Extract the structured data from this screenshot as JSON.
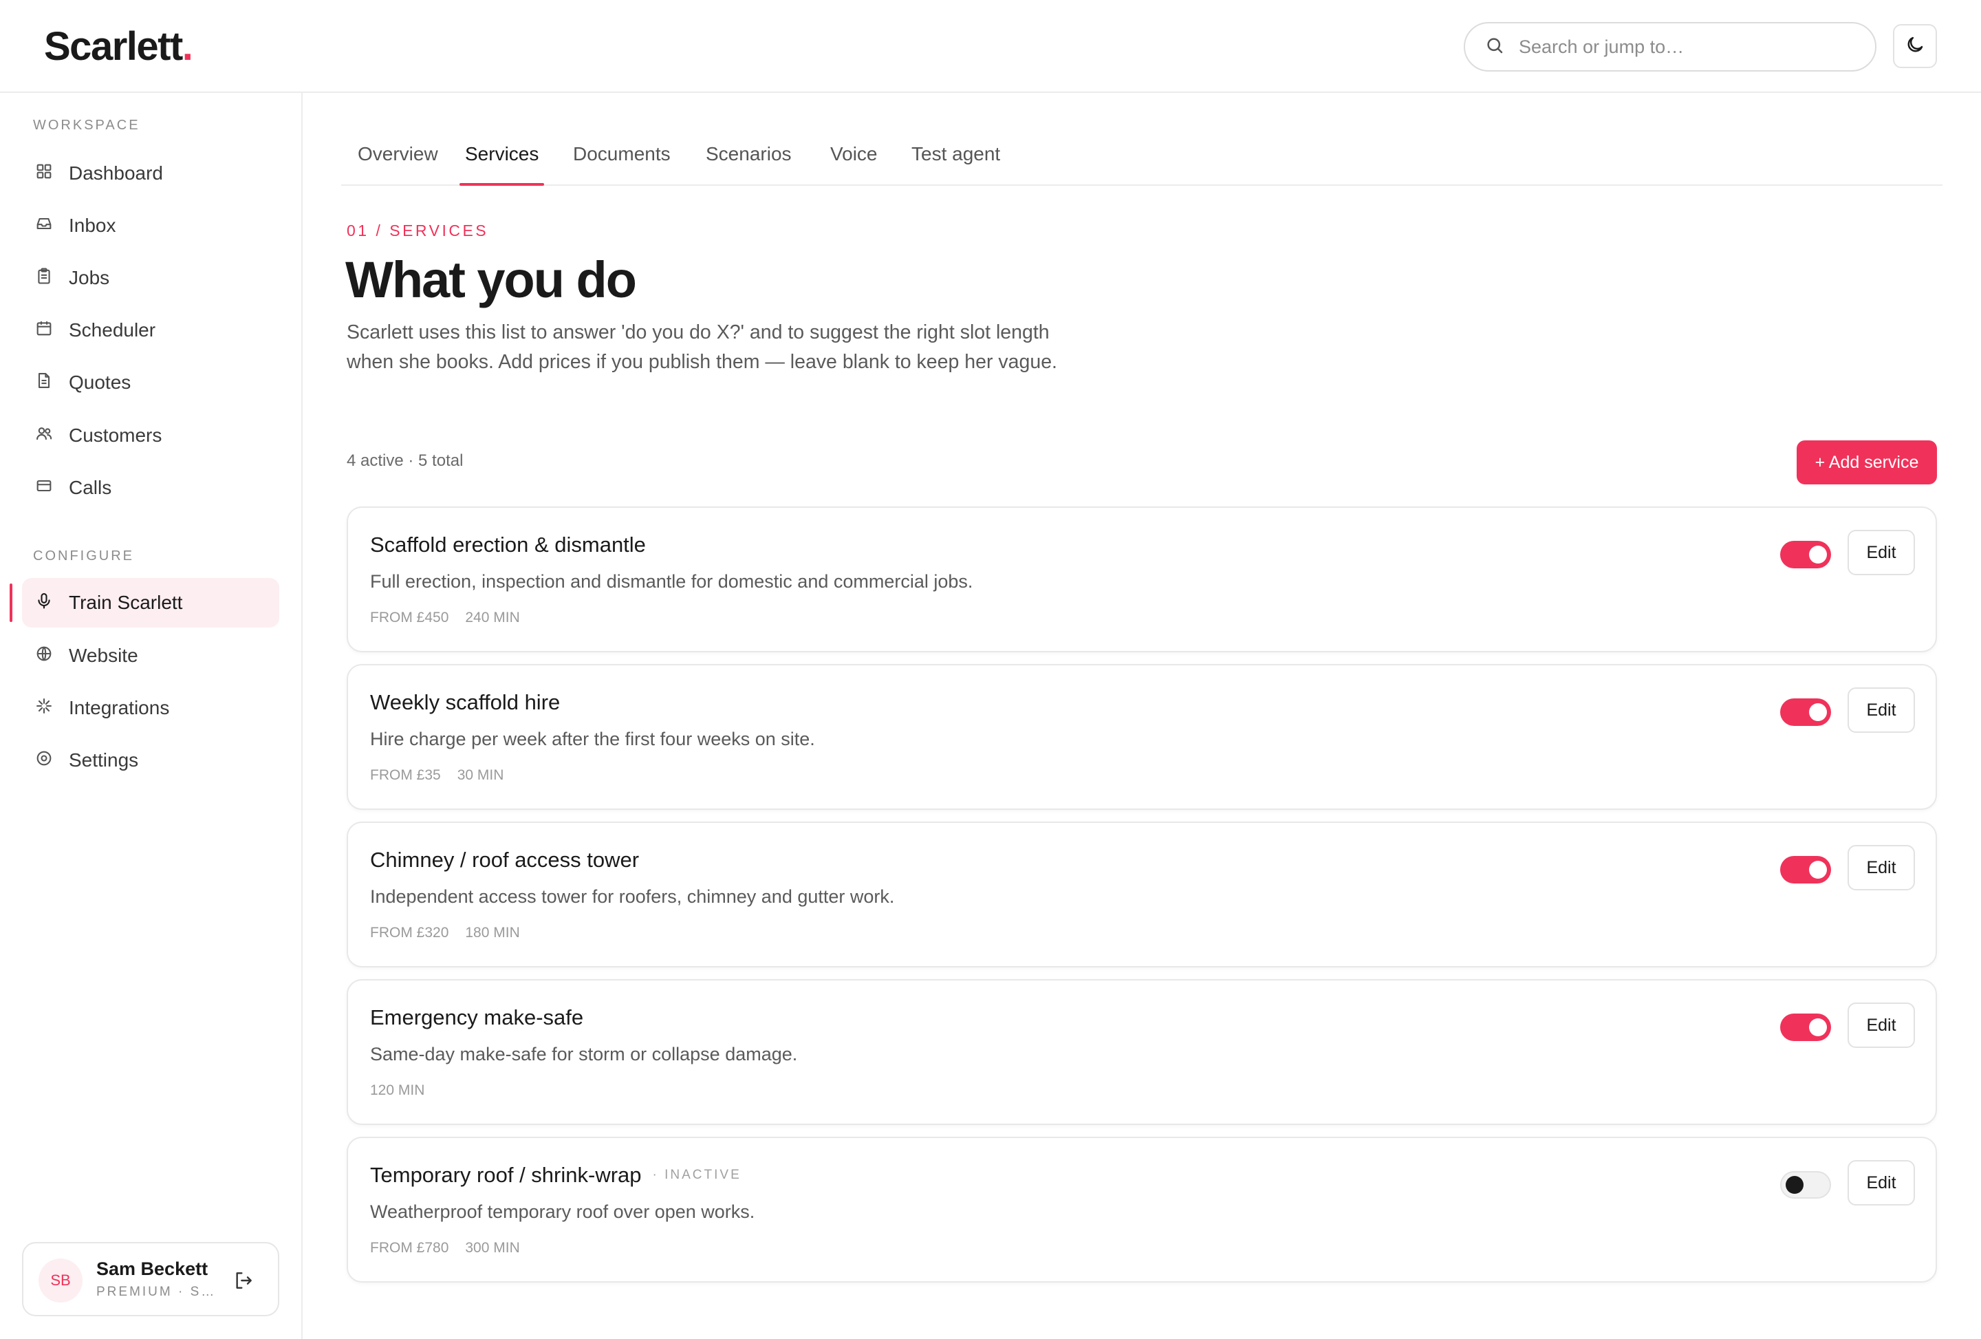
{
  "app": {
    "logo_text": "Scarlett",
    "logo_dot": ".",
    "brand_color": "#f0325a"
  },
  "header": {
    "search_placeholder": "Search or jump to…",
    "search_icon": "search-icon",
    "theme_icon": "moon-icon"
  },
  "sidebar": {
    "workspace_label": "WORKSPACE",
    "workspace_items": [
      {
        "label": "Dashboard",
        "icon": "grid-icon"
      },
      {
        "label": "Inbox",
        "icon": "inbox-icon"
      },
      {
        "label": "Jobs",
        "icon": "clipboard-icon"
      },
      {
        "label": "Scheduler",
        "icon": "calendar-icon"
      },
      {
        "label": "Quotes",
        "icon": "document-icon"
      },
      {
        "label": "Customers",
        "icon": "users-icon"
      },
      {
        "label": "Calls",
        "icon": "phone-card-icon"
      }
    ],
    "configure_label": "CONFIGURE",
    "configure_items": [
      {
        "label": "Train Scarlett",
        "icon": "microphone-icon",
        "active": true
      },
      {
        "label": "Website",
        "icon": "globe-icon"
      },
      {
        "label": "Integrations",
        "icon": "sparkle-icon"
      },
      {
        "label": "Settings",
        "icon": "settings-icon"
      }
    ],
    "user": {
      "initials": "SB",
      "name": "Sam Beckett",
      "plan": "PREMIUM · S…"
    }
  },
  "tabs": [
    {
      "label": "Overview"
    },
    {
      "label": "Services",
      "active": true
    },
    {
      "label": "Documents"
    },
    {
      "label": "Scenarios"
    },
    {
      "label": "Voice"
    },
    {
      "label": "Test agent"
    }
  ],
  "main": {
    "eyebrow": "01 / SERVICES",
    "title": "What you do",
    "description": "Scarlett uses this list to answer 'do you do X?' and to suggest the right slot length when she books. Add prices if you publish them — leave blank to keep her vague.",
    "count": "4 active · 5 total",
    "add_button": "+ Add service"
  },
  "services": [
    {
      "title": "Scaffold erection & dismantle",
      "description": "Full erection, inspection and dismantle for domestic and commercial jobs.",
      "price": "FROM £450",
      "duration": "240 MIN",
      "active": true,
      "badge": "",
      "edit_label": "Edit"
    },
    {
      "title": "Weekly scaffold hire",
      "description": "Hire charge per week after the first four weeks on site.",
      "price": "FROM £35",
      "duration": "30 MIN",
      "active": true,
      "badge": "",
      "edit_label": "Edit"
    },
    {
      "title": "Chimney / roof access tower",
      "description": "Independent access tower for roofers, chimney and gutter work.",
      "price": "FROM £320",
      "duration": "180 MIN",
      "active": true,
      "badge": "",
      "edit_label": "Edit"
    },
    {
      "title": "Emergency make-safe",
      "description": "Same-day make-safe for storm or collapse damage.",
      "price": "",
      "duration": "120 MIN",
      "active": true,
      "badge": "",
      "edit_label": "Edit"
    },
    {
      "title": "Temporary roof / shrink-wrap",
      "description": "Weatherproof temporary roof over open works.",
      "price": "FROM £780",
      "duration": "300 MIN",
      "active": false,
      "badge": "· INACTIVE",
      "edit_label": "Edit"
    }
  ]
}
